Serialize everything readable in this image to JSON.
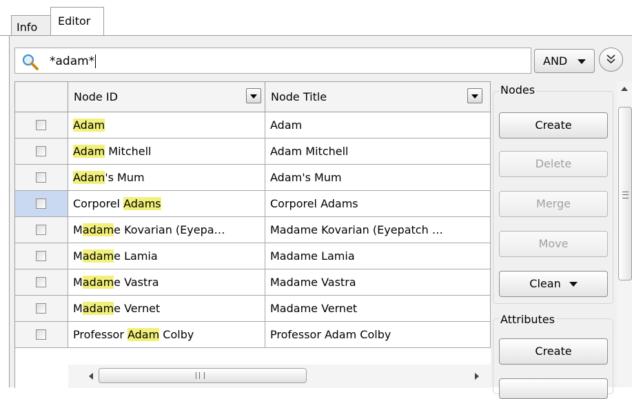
{
  "tabs": [
    {
      "label": "Info",
      "active": false
    },
    {
      "label": "Editor",
      "active": true
    }
  ],
  "search": {
    "value": "*adam*",
    "operator": "AND"
  },
  "table": {
    "columns": [
      "Node ID",
      "Node Title"
    ],
    "rows": [
      {
        "id_pre": "",
        "id_hl": "Adam",
        "id_post": "",
        "title": "Adam",
        "checked": false,
        "selected": false
      },
      {
        "id_pre": "",
        "id_hl": "Adam",
        "id_post": " Mitchell",
        "title": "Adam Mitchell",
        "checked": false,
        "selected": false
      },
      {
        "id_pre": "",
        "id_hl": "Adam",
        "id_post": "'s Mum",
        "title": "Adam's Mum",
        "checked": false,
        "selected": false
      },
      {
        "id_pre": "Corporel ",
        "id_hl": "Adams",
        "id_post": "",
        "title": "Corporel Adams",
        "checked": false,
        "selected": true
      },
      {
        "id_pre": "M",
        "id_hl": "adam",
        "id_post": "e Kovarian (Eyepa…",
        "title": "Madame Kovarian (Eyepatch …",
        "checked": false,
        "selected": false
      },
      {
        "id_pre": "M",
        "id_hl": "adam",
        "id_post": "e Lamia",
        "title": "Madame Lamia",
        "checked": false,
        "selected": false
      },
      {
        "id_pre": "M",
        "id_hl": "adam",
        "id_post": "e Vastra",
        "title": "Madame Vastra",
        "checked": false,
        "selected": false
      },
      {
        "id_pre": "M",
        "id_hl": "adam",
        "id_post": "e Vernet",
        "title": "Madame Vernet",
        "checked": false,
        "selected": false
      },
      {
        "id_pre": "Professor ",
        "id_hl": "Adam",
        "id_post": " Colby",
        "title": "Professor Adam Colby",
        "checked": false,
        "selected": false
      }
    ]
  },
  "nodes_group": {
    "title": "Nodes",
    "create": "Create",
    "delete": "Delete",
    "merge": "Merge",
    "move": "Move",
    "clean": "Clean"
  },
  "attributes_group": {
    "title": "Attributes",
    "create": "Create"
  },
  "colors": {
    "highlight": "#f1f07a",
    "selected_row": "#c9d9f2"
  }
}
